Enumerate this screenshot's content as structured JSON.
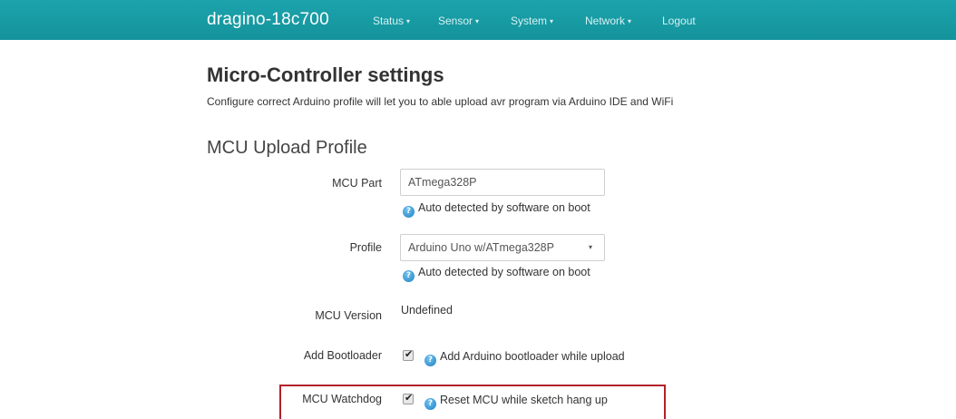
{
  "navbar": {
    "brand": "dragino-18c700",
    "items": [
      {
        "label": "Status",
        "has_caret": true
      },
      {
        "label": "Sensor",
        "has_caret": true
      },
      {
        "label": "System",
        "has_caret": true
      },
      {
        "label": "Network",
        "has_caret": true
      },
      {
        "label": "Logout",
        "has_caret": false
      }
    ],
    "caret_glyph": "▾"
  },
  "page": {
    "title": "Micro-Controller settings",
    "description": "Configure correct Arduino profile will let you to able upload avr program via Arduino IDE and WiFi"
  },
  "section": {
    "title": "MCU Upload Profile"
  },
  "form": {
    "mcu_part": {
      "label": "MCU Part",
      "value": "ATmega328P",
      "hint": "Auto detected by software on boot"
    },
    "profile": {
      "label": "Profile",
      "selected": "Arduino Uno w/ATmega328P",
      "hint": "Auto detected by software on boot"
    },
    "mcu_version": {
      "label": "MCU Version",
      "value": "Undefined"
    },
    "add_bootloader": {
      "label": "Add Bootloader",
      "checked": true,
      "hint": "Add Arduino bootloader while upload"
    },
    "mcu_watchdog": {
      "label": "MCU Watchdog",
      "checked": true,
      "hint": "Reset MCU while sketch hang up",
      "highlighted": true
    }
  },
  "icons": {
    "help": "help-icon",
    "help_glyph": "?",
    "check_glyph": "✔"
  },
  "colors": {
    "navbar_bg": "#1ca3ac",
    "highlight_border": "#b3202a",
    "help_icon": "#1f7fc3"
  }
}
